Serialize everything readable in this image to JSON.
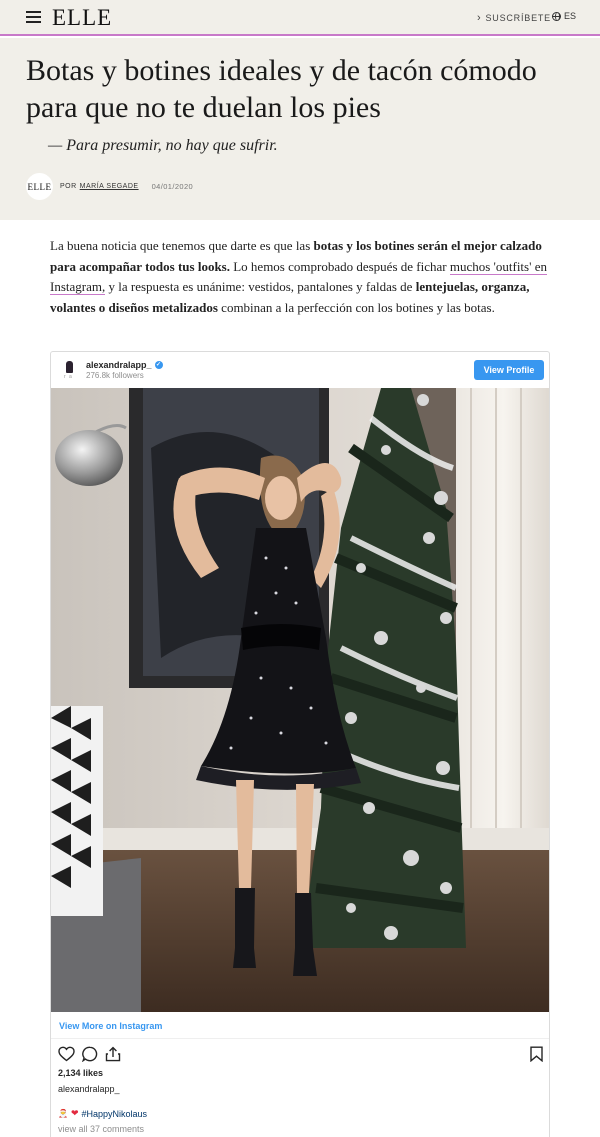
{
  "nav": {
    "logo": "ELLE",
    "subscribe_label": "SUSCRÍBETE",
    "language": "ES"
  },
  "article": {
    "headline": "Botas y botines ideales y de tacón cómodo para que no te duelan los pies",
    "subheadline": "— Para presumir, no hay que sufrir.",
    "byline": {
      "avatar_text": "ELLE",
      "prefix": "POR",
      "author": "MARÍA SEGADE",
      "date": "04/01/2020"
    },
    "paragraph": {
      "p1": "La buena noticia que tenemos que darte es que las ",
      "b1": "botas y los botines serán el mejor calzado para acompañar todos tus looks.",
      "p2": " Lo hemos comprobado después de fichar ",
      "link": "muchos 'outfits' en Instagram,",
      "p3": " y la respuesta es unánime: vestidos, pantalones y faldas de ",
      "b2": "lentejuelas, organza, volantes o diseños metalizados",
      "p4": " combinan a la perfección con los botines y las botas."
    }
  },
  "instagram": {
    "username": "alexandralapp_",
    "followers": "276.8k followers",
    "avatar_caption": "r a",
    "view_profile_label": "View Profile",
    "view_more_label": "View More on Instagram",
    "likes": "2,134 likes",
    "caption_user": "alexandralapp_",
    "caption_emoji": "🎅",
    "caption_heart": "❤",
    "hashtag": "#HappyNikolaus",
    "comments_link": "view all 37 comments",
    "icons": [
      "heart-icon",
      "comment-icon",
      "share-icon",
      "bookmark-icon"
    ],
    "accent_color": "#3897f0"
  },
  "colors": {
    "header_background": "#f1efe9",
    "accent_rule": "#c879c9"
  }
}
